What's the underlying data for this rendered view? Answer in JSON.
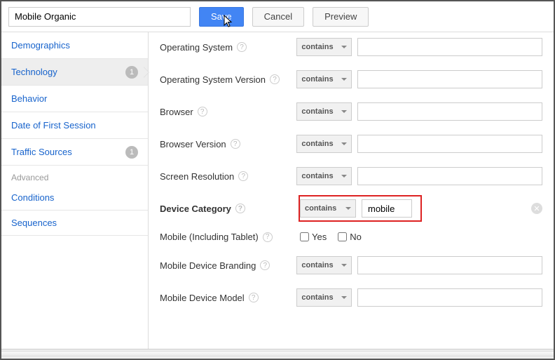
{
  "toolbar": {
    "segment_name": "Mobile Organic",
    "save": "Save",
    "cancel": "Cancel",
    "preview": "Preview"
  },
  "sidebar": {
    "items": [
      {
        "label": "Demographics",
        "badge": ""
      },
      {
        "label": "Technology",
        "badge": "1"
      },
      {
        "label": "Behavior",
        "badge": ""
      },
      {
        "label": "Date of First Session",
        "badge": ""
      },
      {
        "label": "Traffic Sources",
        "badge": "1"
      }
    ],
    "advanced_heading": "Advanced",
    "advanced": [
      {
        "label": "Conditions"
      },
      {
        "label": "Sequences"
      }
    ]
  },
  "config": {
    "rows": [
      {
        "label": "Operating System",
        "bold": false,
        "operator": "contains",
        "value": "",
        "input": "text"
      },
      {
        "label": "Operating System Version",
        "bold": false,
        "operator": "contains",
        "value": "",
        "input": "text"
      },
      {
        "label": "Browser",
        "bold": false,
        "operator": "contains",
        "value": "",
        "input": "text"
      },
      {
        "label": "Browser Version",
        "bold": false,
        "operator": "contains",
        "value": "",
        "input": "text"
      },
      {
        "label": "Screen Resolution",
        "bold": false,
        "operator": "contains",
        "value": "",
        "input": "text"
      },
      {
        "label": "Device Category",
        "bold": true,
        "operator": "contains",
        "value": "mobile",
        "input": "short",
        "highlight": true,
        "clear": true
      },
      {
        "label": "Mobile (Including Tablet)",
        "bold": false,
        "input": "yesno",
        "yes": "Yes",
        "no": "No"
      },
      {
        "label": "Mobile Device Branding",
        "bold": false,
        "operator": "contains",
        "value": "",
        "input": "text"
      },
      {
        "label": "Mobile Device Model",
        "bold": false,
        "operator": "contains",
        "value": "",
        "input": "text"
      }
    ]
  }
}
